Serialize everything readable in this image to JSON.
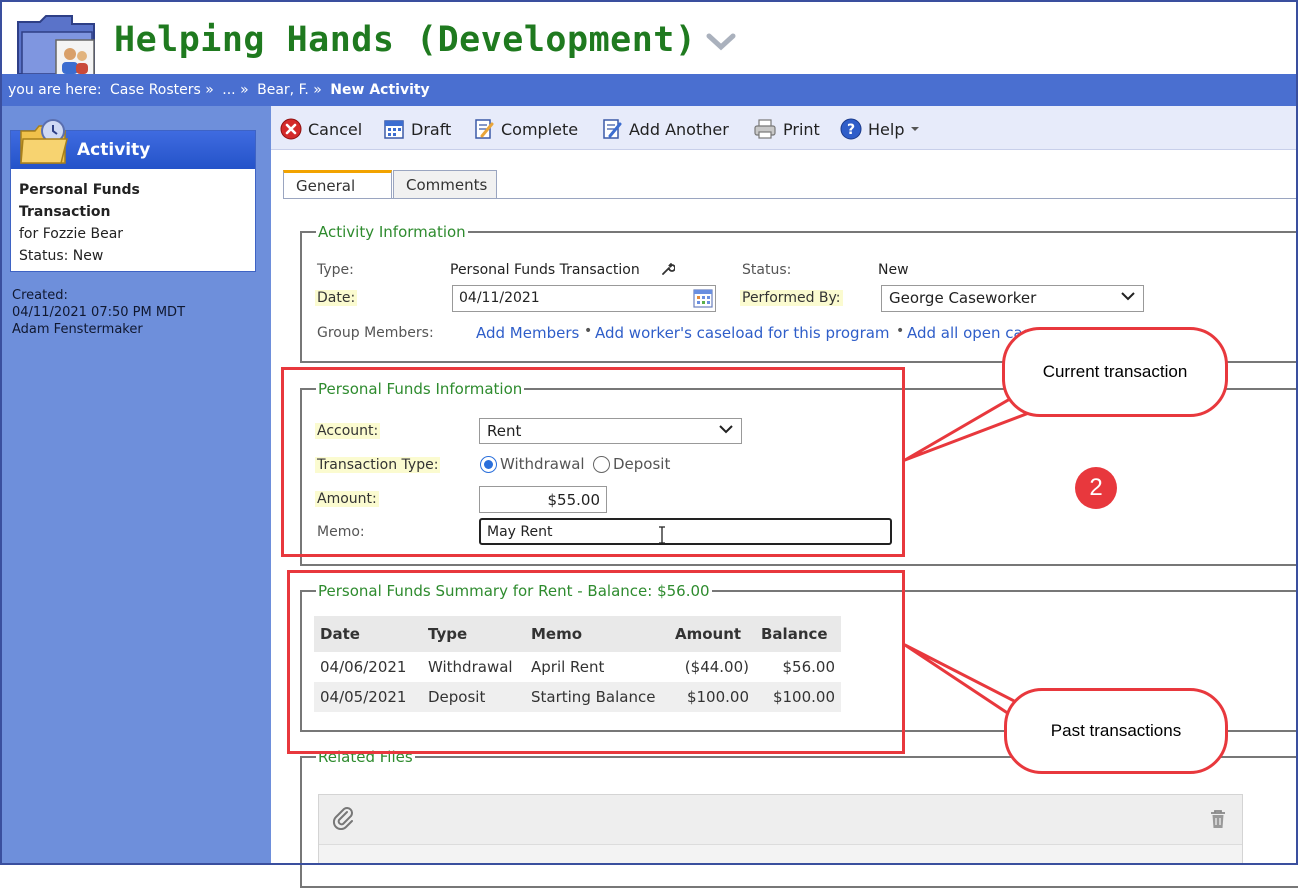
{
  "app": {
    "title": "Helping Hands (Development)"
  },
  "breadcrumb": {
    "prefix": "you are here:",
    "items": [
      "Case Rosters »",
      "... »",
      "Bear, F. »"
    ],
    "current": "New Activity"
  },
  "sidebar": {
    "card_title": "Activity",
    "activity_name_line1": "Personal Funds",
    "activity_name_line2": "Transaction",
    "client": "for Fozzie Bear",
    "status": "Status: New",
    "created_label": "Created:",
    "created_date": "04/11/2021 07:50 PM MDT",
    "created_by": "Adam Fenstermaker"
  },
  "toolbar": {
    "cancel": "Cancel",
    "draft": "Draft",
    "complete": "Complete",
    "add_another": "Add Another",
    "print": "Print",
    "help": "Help"
  },
  "tabs": {
    "general": "General",
    "comments": "Comments"
  },
  "activity_info": {
    "legend": "Activity Information",
    "type_label": "Type:",
    "type_value": "Personal Funds Transaction",
    "status_label": "Status:",
    "status_value": "New",
    "date_label": "Date:",
    "date_value": "04/11/2021",
    "performed_by_label": "Performed By:",
    "performed_by_value": "George Caseworker",
    "group_members_label": "Group Members:",
    "add_members": "Add Members",
    "add_caseload": "Add worker's caseload for this program",
    "add_all_open": "Add all open cas"
  },
  "personal_funds": {
    "legend": "Personal Funds Information",
    "account_label": "Account:",
    "account_value": "Rent",
    "transaction_type_label": "Transaction Type:",
    "withdrawal": "Withdrawal",
    "deposit": "Deposit",
    "selected_type": "Withdrawal",
    "amount_label": "Amount:",
    "amount_value": "$55.00",
    "memo_label": "Memo:",
    "memo_value": "May Rent"
  },
  "summary": {
    "legend": "Personal Funds Summary for Rent - Balance: $56.00",
    "headers": {
      "date": "Date",
      "type": "Type",
      "memo": "Memo",
      "amount": "Amount",
      "balance": "Balance"
    },
    "rows": [
      {
        "date": "04/06/2021",
        "type": "Withdrawal",
        "memo": "April Rent",
        "amount": "($44.00)",
        "balance": "$56.00"
      },
      {
        "date": "04/05/2021",
        "type": "Deposit",
        "memo": "Starting Balance",
        "amount": "$100.00",
        "balance": "$100.00"
      }
    ]
  },
  "related_files": {
    "legend": "Related Files"
  },
  "annotations": {
    "current_callout": "Current transaction",
    "past_callout": "Past transactions",
    "step_badge": "2",
    "color": "#e8383d"
  },
  "colors": {
    "title_green": "#1f7a1f",
    "breadcrumb_blue": "#4a6fd0",
    "sidebar_blue": "#6e8fdb",
    "legend_green": "#2e8b2e",
    "link_blue": "#2f5ec9"
  },
  "icons": [
    "folder-people-icon",
    "chevron-down-icon",
    "activity-folder-icon",
    "cancel-icon",
    "calendar-icon",
    "complete-icon",
    "add-another-icon",
    "print-icon",
    "help-icon",
    "paperclip-icon",
    "trash-icon"
  ]
}
